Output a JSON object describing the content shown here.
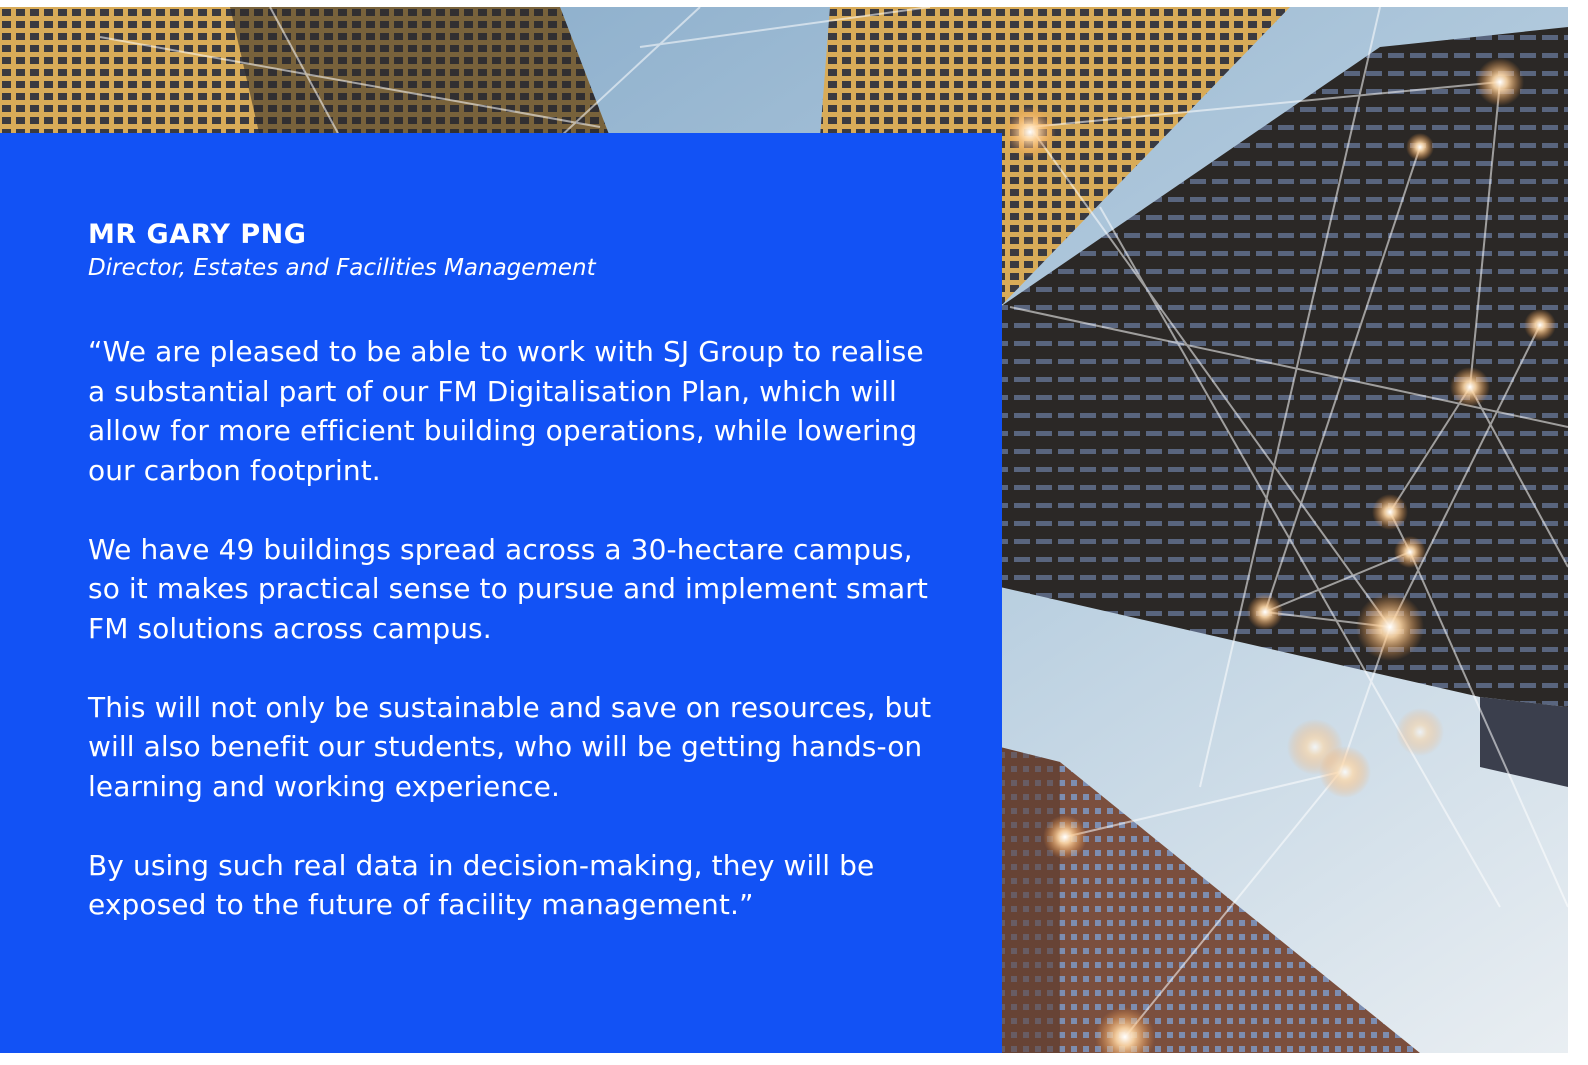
{
  "colors": {
    "card": "#1252f5",
    "text": "#ffffff",
    "sky": "#a9c3d8",
    "tower_dark": "#2a2726",
    "tower_gold": "#c79a4a",
    "glow": "#ffb872"
  },
  "background": {
    "image": "city-buildings-network-photo"
  },
  "testimonial": {
    "name": "MR GARY PNG",
    "role": "Director, Estates and Facilities Management",
    "paragraphs": [
      "“We are pleased to be able to work with SJ Group to realise a substantial part of our FM Digitalisation Plan, which will allow for more efficient building operations, while lowering our carbon footprint.",
      "We have 49 buildings spread across a 30-hectare campus, so it makes practical sense to pursue and implement smart FM solutions across campus.",
      "This will not only be sustainable and save on resources, but will also benefit our students, who will be getting hands-on learning and working experience.",
      "By using such real data in decision-making, they will be exposed to the future of facility management.”"
    ]
  }
}
